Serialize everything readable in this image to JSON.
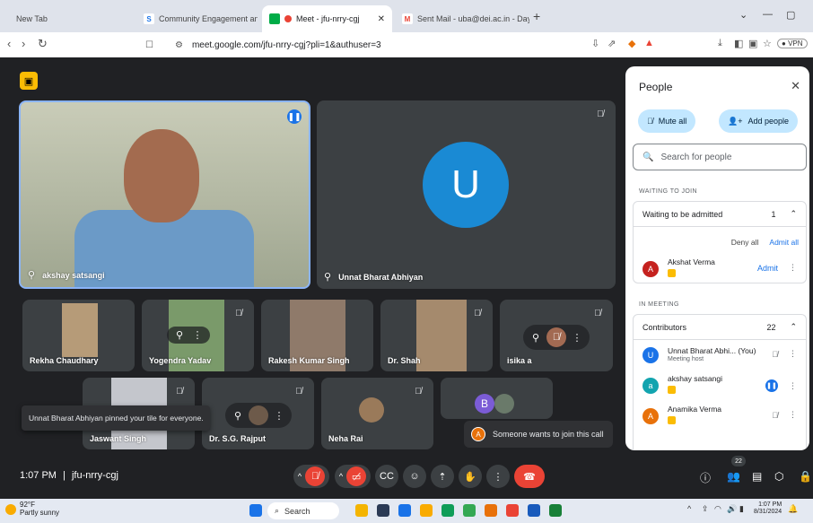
{
  "browser": {
    "tabs": [
      {
        "label": "New Tab"
      },
      {
        "label": "Community Engagement and Social"
      },
      {
        "label": "Meet - jfu-nrry-cgj"
      },
      {
        "label": "Sent Mail - uba@dei.ac.in - Dayalba"
      }
    ],
    "url": "meet.google.com/jfu-nrry-cgj?pli=1&authuser=3",
    "vpn_label": "VPN"
  },
  "meet": {
    "main_tiles": [
      {
        "name": "akshay satsangi"
      },
      {
        "name": "Unnat Bharat Abhiyan",
        "avatar_letter": "U"
      }
    ],
    "grid_tiles": [
      {
        "name": "Rekha Chaudhary"
      },
      {
        "name": "Yogendra Yadav"
      },
      {
        "name": "Rakesh Kumar Singh"
      },
      {
        "name": "Dr. Shah"
      },
      {
        "name": "isika a"
      },
      {
        "name": "Jaswant Singh"
      },
      {
        "name": "Dr. S.G. Rajput"
      },
      {
        "name": "Neha Rai"
      },
      {
        "name": "B"
      }
    ],
    "toast_pinned": "Unnat Bharat Abhiyan pinned your tile for everyone.",
    "toast_join": "Someone wants to join this call",
    "join_avatar": "A",
    "time": "1:07 PM",
    "meeting_code": "jfu-nrry-cgj",
    "people_count": "22"
  },
  "panel": {
    "title": "People",
    "mute_all": "Mute all",
    "add_people": "Add people",
    "search_placeholder": "Search for people",
    "waiting_label": "WAITING TO JOIN",
    "waiting_group": "Waiting to be admitted",
    "waiting_count": "1",
    "deny_all": "Deny all",
    "admit_all": "Admit all",
    "waiting_person": {
      "name": "Akshat Verma",
      "letter": "A"
    },
    "admit": "Admit",
    "in_meeting_label": "IN MEETING",
    "contributors_label": "Contributors",
    "contributors_count": "22",
    "members": [
      {
        "name": "Unnat Bharat Abhi... (You)",
        "sub": "Meeting host",
        "letter": "U"
      },
      {
        "name": "akshay satsangi",
        "letter": "a"
      },
      {
        "name": "Anamika Verma",
        "letter": "A"
      }
    ]
  },
  "taskbar": {
    "temp": "92°F",
    "weather": "Partly sunny",
    "search": "Search",
    "time": "1:07 PM",
    "date": "8/31/2024"
  },
  "colors": {
    "accent": "#1a73e8",
    "danger": "#ea4335",
    "bg": "#202124"
  }
}
